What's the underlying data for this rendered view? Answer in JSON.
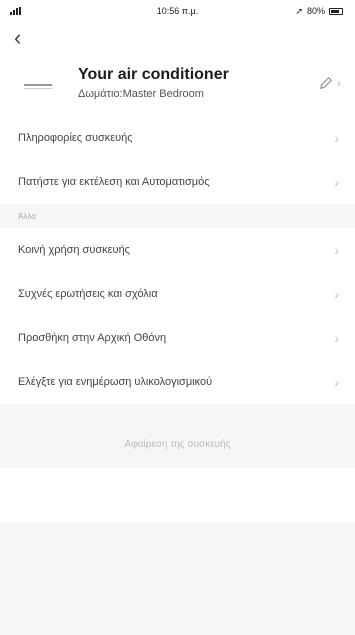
{
  "status": {
    "time": "10:56 π.μ.",
    "battery": "80%"
  },
  "device": {
    "title": "Your air conditioner",
    "room": "Δωμάτιο:Master Bedroom"
  },
  "rows_top": [
    {
      "label": "Πληροφορίες συσκευής"
    },
    {
      "label": "Πατήστε για εκτέλεση και Αυτοματισμός"
    }
  ],
  "section": {
    "label": "Άλλα"
  },
  "rows_other": [
    {
      "label": "Κοινή χρήση συσκευής"
    },
    {
      "label": "Συχνές ερωτήσεις και σχόλια"
    },
    {
      "label": "Προσθήκη στην Αρχική Οθόνη"
    },
    {
      "label": "Ελέγξτε για ενημέρωση υλικολογισμικού"
    }
  ],
  "remove": {
    "label": "Αφαίρεση της συσκευής"
  },
  "icons": {
    "back": "chevron-left-icon",
    "edit": "pencil-icon",
    "row": "chevron-right-icon"
  }
}
